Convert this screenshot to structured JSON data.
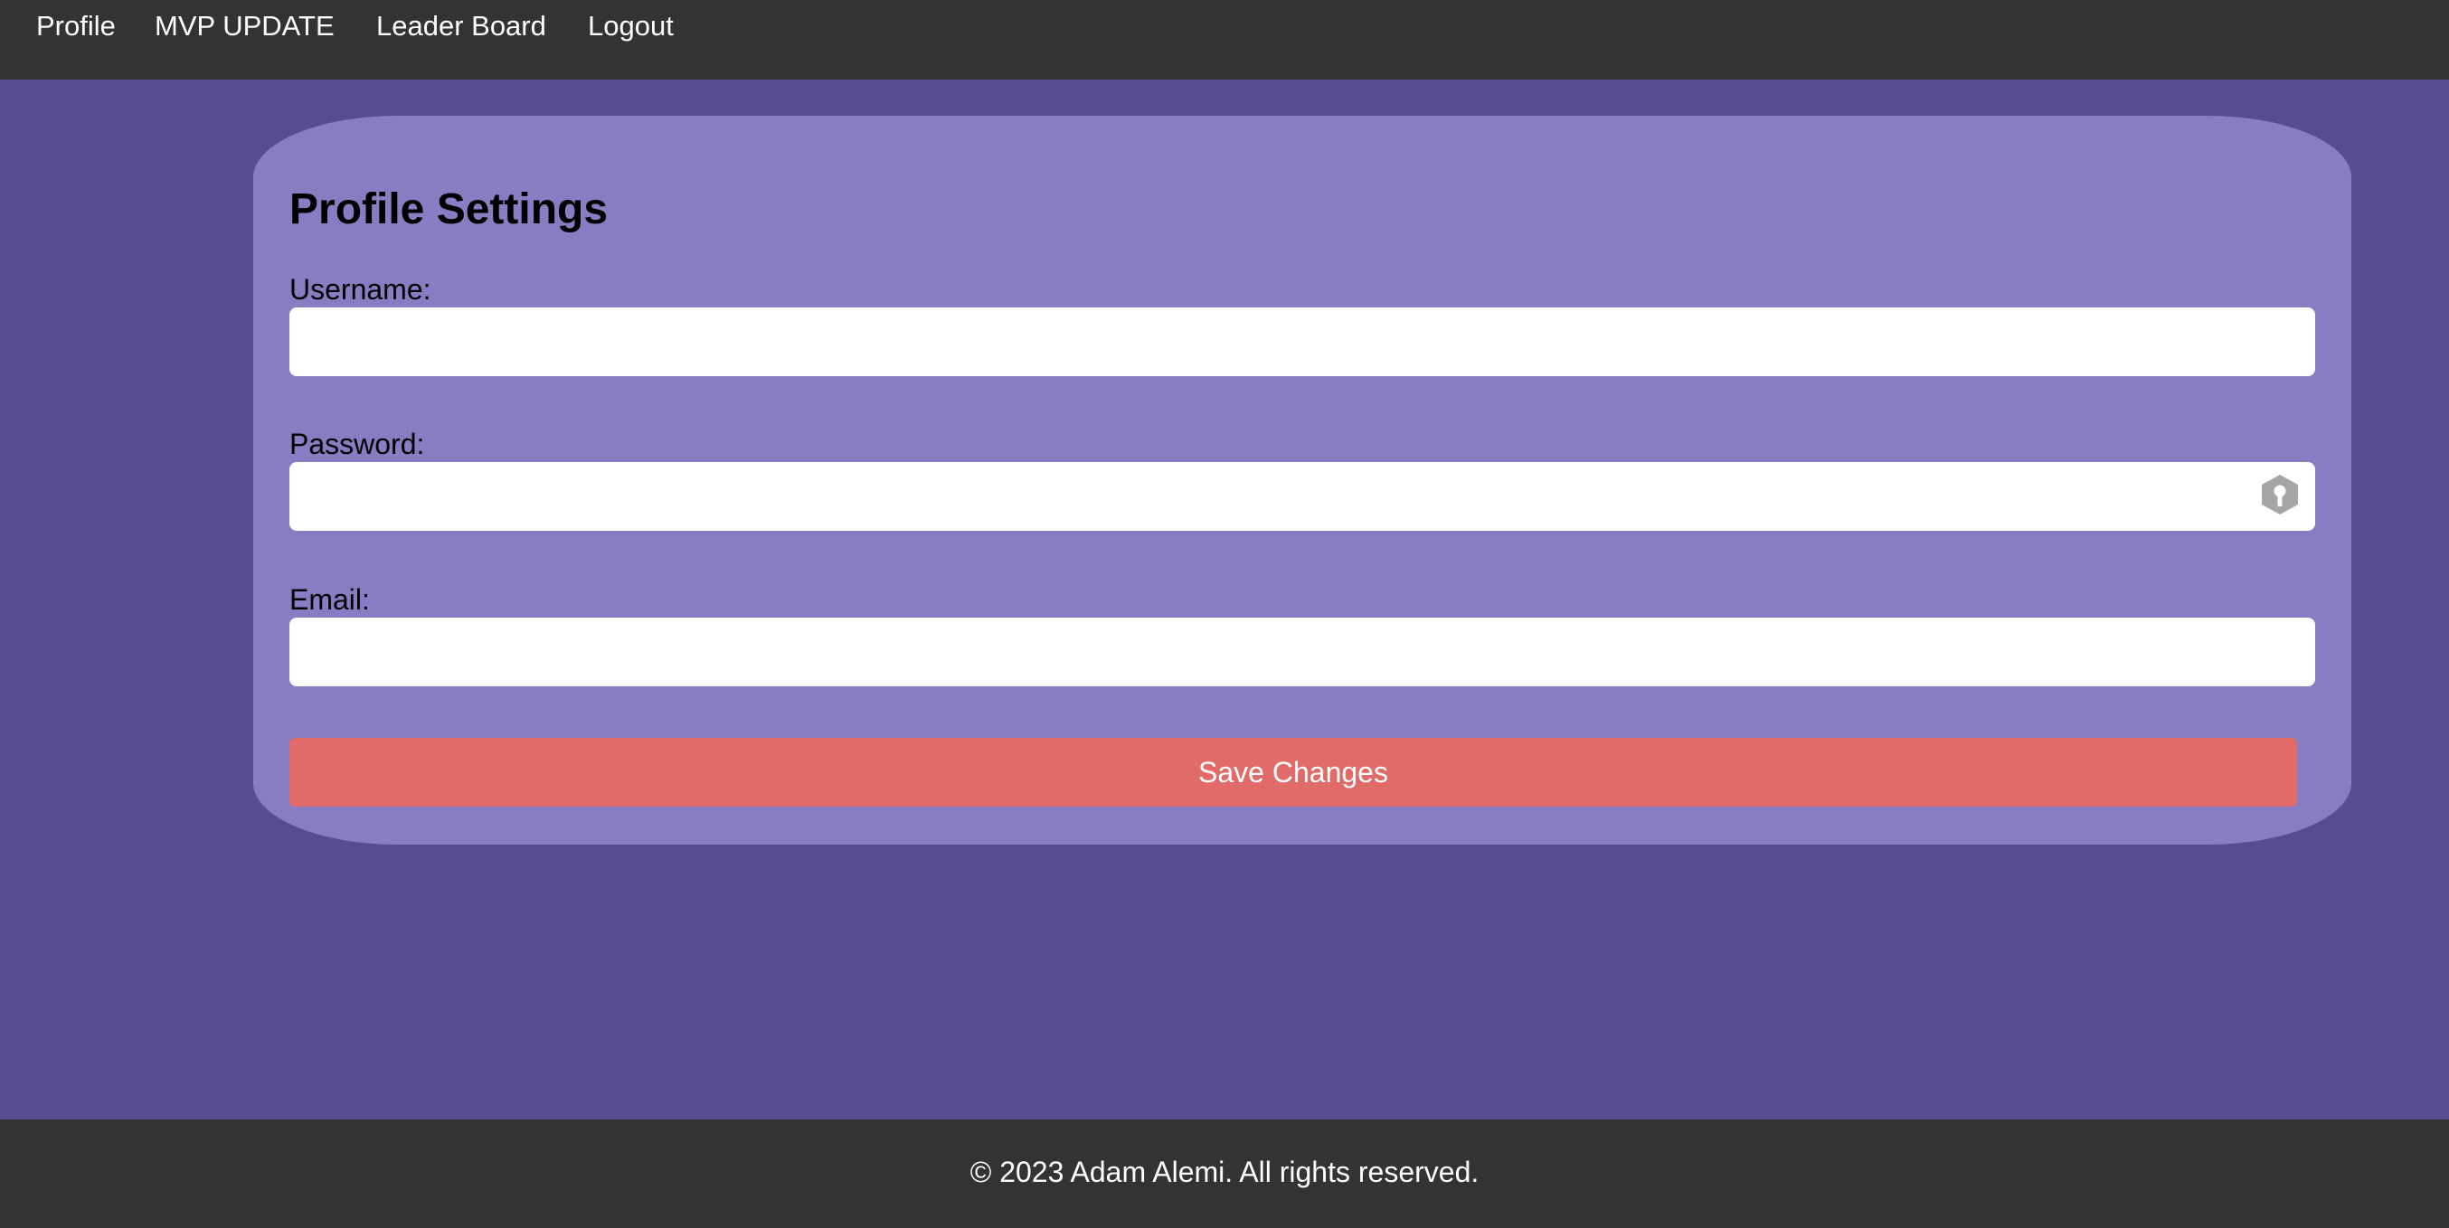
{
  "nav": {
    "items": [
      {
        "label": "Profile"
      },
      {
        "label": "MVP UPDATE"
      },
      {
        "label": "Leader Board"
      },
      {
        "label": "Logout"
      }
    ]
  },
  "form": {
    "title": "Profile Settings",
    "username_label": "Username:",
    "username_value": "",
    "password_label": "Password:",
    "password_value": "",
    "password_icon": "key-icon",
    "email_label": "Email:",
    "email_value": "",
    "save_label": "Save Changes"
  },
  "footer": {
    "text": "© 2023 Adam Alemi. All rights reserved."
  },
  "colors": {
    "nav_bg": "#333333",
    "page_bg": "#584C91",
    "card_bg": "#877DC2",
    "save_button": "#E06B69"
  }
}
